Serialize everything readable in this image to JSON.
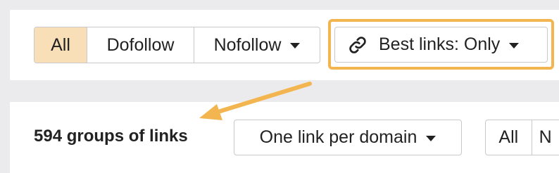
{
  "filters": {
    "all_label": "All",
    "dofollow_label": "Dofollow",
    "nofollow_label": "Nofollow"
  },
  "best_links": {
    "label": "Best links: Only"
  },
  "results": {
    "count_text": "594 groups of links",
    "grouping_label": "One link per domain",
    "bottom_all_label": "All",
    "bottom_next_label": "N"
  },
  "colors": {
    "highlight": "#f3b54f",
    "active_segment": "#f9dfb8",
    "page_background": "#ebebed"
  },
  "icons": {
    "best_links": "link-icon",
    "dropdown": "caret-down-icon"
  }
}
